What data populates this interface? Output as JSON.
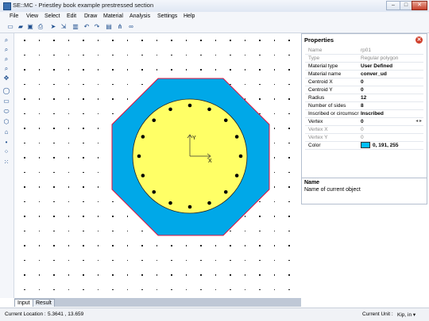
{
  "window": {
    "title": "SE::MC - Priestley book example prestressed section",
    "min": "–",
    "max": "□",
    "close": "✕"
  },
  "menu": [
    "File",
    "View",
    "Select",
    "Edit",
    "Draw",
    "Material",
    "Analysis",
    "Settings",
    "Help"
  ],
  "toolbar_icons": [
    "new-file-icon",
    "open-folder-icon",
    "save-icon",
    "print-icon",
    "select-arrow-icon",
    "select-node-icon",
    "delete-icon",
    "undo-icon",
    "redo-icon",
    "document-icon",
    "hierarchy-icon",
    "link-icon"
  ],
  "left_tools": [
    "zoom-in-icon",
    "zoom-out-icon",
    "zoom-fit-icon",
    "zoom-window-icon",
    "pan-icon",
    "circle-icon",
    "rectangle-icon",
    "ellipse-icon",
    "polygon-icon",
    "rebar-icon",
    "point-icon",
    "circle-rebar-icon",
    "rect-rebar-icon"
  ],
  "properties": {
    "title": "Properties",
    "rows": [
      {
        "key": "Name",
        "value": "rp01",
        "state": "disabled"
      },
      {
        "key": "Type",
        "value": "Regular polygon",
        "state": "disabled"
      },
      {
        "key": "Material type",
        "value": "User Defined",
        "state": "bold"
      },
      {
        "key": "Material name",
        "value": "conver_ud",
        "state": "bold"
      },
      {
        "key": "Centroid  X",
        "value": "0",
        "state": "bold"
      },
      {
        "key": "Centroid  Y",
        "value": "0",
        "state": "bold"
      },
      {
        "key": "Radius",
        "value": "12",
        "state": "bold"
      },
      {
        "key": "Number of sides",
        "value": "8",
        "state": "bold"
      },
      {
        "key": "Inscribed or circumscri",
        "value": "Inscribed",
        "state": "bold"
      },
      {
        "key": "Vertex",
        "value": "0",
        "state": "bold"
      },
      {
        "key": "Vertex X",
        "value": "0",
        "state": "disabled"
      },
      {
        "key": "Vertex Y",
        "value": "0",
        "state": "disabled"
      },
      {
        "key": "Color",
        "value": "0, 191, 255",
        "state": "bold"
      }
    ],
    "desc_title": "Name",
    "desc_text": "Name of current object"
  },
  "canvas": {
    "axis_x_label": "X",
    "axis_y_label": "Y",
    "octagon_fill": "#00a8e8",
    "octagon_stroke": "#e8103c",
    "circle_fill": "#ffff66",
    "rebar_count": 16
  },
  "tabs": [
    "Input",
    "Result"
  ],
  "status": {
    "location_label": "Current Location :",
    "location_value": "5.3641 , 13.659",
    "unit_label": "Current Unit :",
    "unit_value": "Kip, in ▾"
  }
}
